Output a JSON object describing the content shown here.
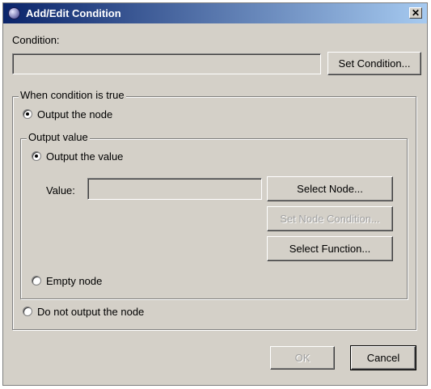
{
  "window": {
    "title": "Add/Edit Condition",
    "close_label": "✕"
  },
  "condition": {
    "label": "Condition:",
    "value": "",
    "set_button": "Set Condition..."
  },
  "when_true": {
    "legend": "When condition is true",
    "output_node_label": "Output the node",
    "output_value_group": {
      "legend": "Output value",
      "output_value_label": "Output the value",
      "value_label": "Value:",
      "value_field": "",
      "select_node_button": "Select Node...",
      "set_node_condition_button": "Set Node Condition...",
      "select_function_button": "Select Function...",
      "empty_node_label": "Empty node"
    },
    "do_not_output_label": "Do not output the node"
  },
  "footer": {
    "ok_label": "OK",
    "cancel_label": "Cancel"
  },
  "state": {
    "output_node_selected": true,
    "output_value_selected": true,
    "ok_enabled": false,
    "set_node_condition_enabled": false
  }
}
